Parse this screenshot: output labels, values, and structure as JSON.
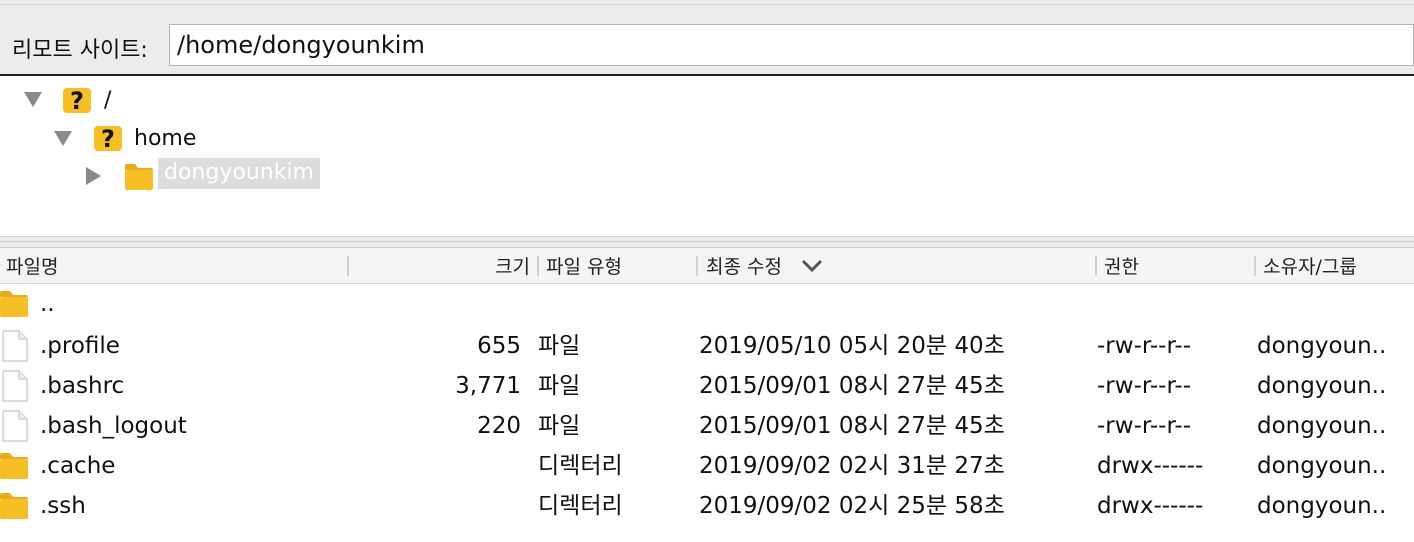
{
  "path_bar": {
    "label": "리모트 사이트:",
    "value": "/home/dongyounkim"
  },
  "tree": {
    "nodes": [
      {
        "label": "/",
        "expanded": true,
        "icon": "unknown-folder-icon"
      },
      {
        "label": "home",
        "expanded": true,
        "icon": "unknown-folder-icon"
      },
      {
        "label": "dongyounkim",
        "expanded": false,
        "selected": true,
        "icon": "folder-icon"
      }
    ]
  },
  "columns": {
    "name": "파일명",
    "size": "크기",
    "type": "파일 유형",
    "modified": "최종 수정",
    "permissions": "권한",
    "owner": "소유자/그룹"
  },
  "sort": {
    "column": "modified",
    "direction": "descending"
  },
  "files": [
    {
      "name": "..",
      "size": "",
      "type": "",
      "modified": "",
      "permissions": "",
      "owner": "",
      "icon": "folder-icon"
    },
    {
      "name": ".profile",
      "size": "655",
      "type": "파일",
      "modified": "2019/05/10 05시 20분 40초",
      "permissions": "-rw-r--r--",
      "owner": "dongyoun..",
      "icon": "file-icon"
    },
    {
      "name": ".bashrc",
      "size": "3,771",
      "type": "파일",
      "modified": "2015/09/01 08시 27분 45초",
      "permissions": "-rw-r--r--",
      "owner": "dongyoun..",
      "icon": "file-icon"
    },
    {
      "name": ".bash_logout",
      "size": "220",
      "type": "파일",
      "modified": "2015/09/01 08시 27분 45초",
      "permissions": "-rw-r--r--",
      "owner": "dongyoun..",
      "icon": "file-icon"
    },
    {
      "name": ".cache",
      "size": "",
      "type": "디렉터리",
      "modified": "2019/09/02 02시 31분 27초",
      "permissions": "drwx------",
      "owner": "dongyoun..",
      "icon": "folder-icon"
    },
    {
      "name": ".ssh",
      "size": "",
      "type": "디렉터리",
      "modified": "2019/09/02 02시 25분 58초",
      "permissions": "drwx------",
      "owner": "dongyoun..",
      "icon": "folder-icon"
    }
  ],
  "colors": {
    "folder": "#f6bf26",
    "selection_bg": "#dcdcdc",
    "toolbar_bg": "#ececec"
  }
}
